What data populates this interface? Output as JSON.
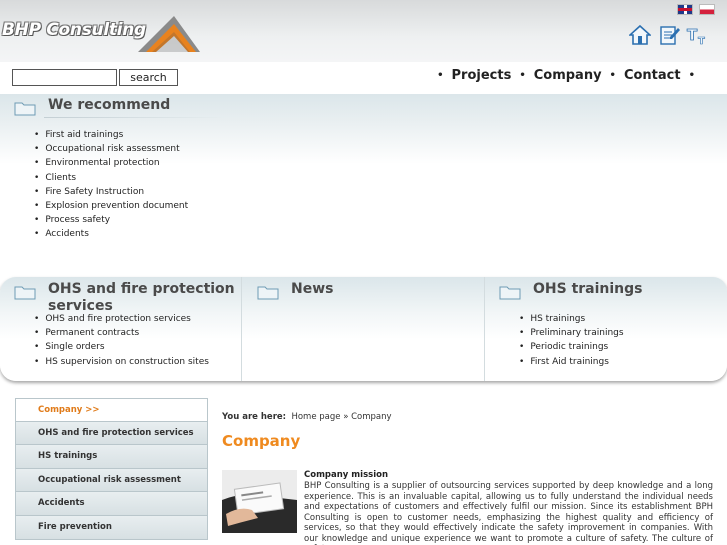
{
  "header": {
    "logo_text": "BHP Consulting",
    "icons": [
      "home-icon",
      "edit-icon",
      "text-size-icon"
    ],
    "languages": [
      "en-flag-icon",
      "pl-flag-icon"
    ]
  },
  "search": {
    "value": "",
    "placeholder": "",
    "button": "search"
  },
  "nav": [
    "Projects",
    "Company",
    "Contact"
  ],
  "recommend": {
    "title": "We recommend",
    "items": [
      "First aid trainings",
      "Occupational risk assessment",
      "Environmental protection",
      "Clients",
      "Fire Safety Instruction",
      "Explosion prevention document",
      "Process safety",
      "Accidents"
    ]
  },
  "columns": [
    {
      "title": "OHS and fire protection services",
      "items": [
        "OHS and fire protection services",
        "Permanent contracts",
        "Single orders",
        "HS supervision on construction sites"
      ]
    },
    {
      "title": "News",
      "items": []
    },
    {
      "title": "OHS trainings",
      "items": [
        "HS trainings",
        "Preliminary trainings",
        "Periodic trainings",
        "First Aid trainings"
      ]
    }
  ],
  "side_menu": [
    "Company >>",
    "OHS and fire protection services",
    "HS trainings",
    "Occupational risk assessment",
    "Accidents",
    "Fire prevention"
  ],
  "breadcrumb": {
    "label": "You are here:",
    "home": "Home page",
    "sep": "»",
    "current": "Company"
  },
  "content": {
    "title": "Company",
    "mission_title": "Company mission",
    "mission_text": "BHP Consulting is a supplier of outsourcing services supported by deep knowledge and a long experience. This is an invaluable capital, allowing us to fully understand the individual needs and expectations of customers and effectively fulfil our mission. Since its establishment BPH Consulting is open to customer needs, emphasizing the highest quality and efficiency of services, so that they would effectively indicate the safety improvement in companies. With our knowledge and unique experience we want to promote a culture of safety. The culture of safety"
  },
  "colors": {
    "accent": "#ef8a1f",
    "band": "#dbe6ea",
    "menu": "#d7e0e3"
  }
}
